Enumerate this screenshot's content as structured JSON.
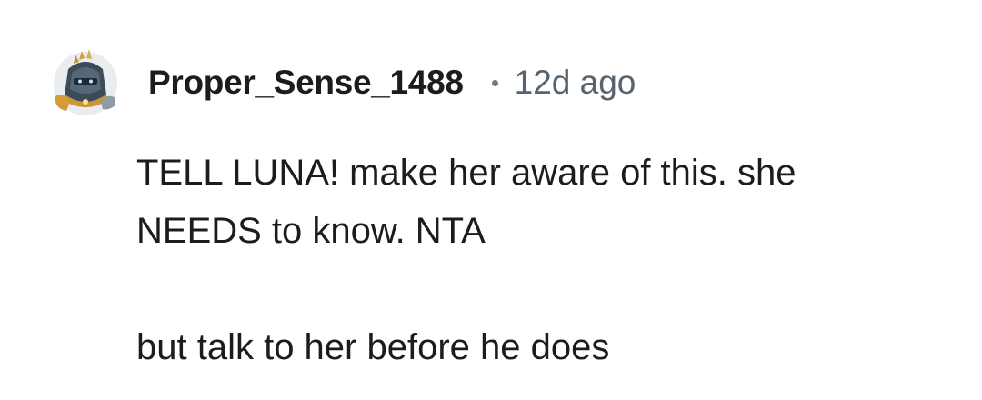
{
  "comment": {
    "avatar_icon": "knight-helmet-avatar-icon",
    "username": "Proper_Sense_1488",
    "separator": "•",
    "timestamp": "12d ago",
    "lines": [
      "TELL LUNA! make her aware of this. she",
      "NEEDS to know. NTA",
      "but talk to her before he does"
    ]
  },
  "colors": {
    "background": "#ffffff",
    "text": "#1c1c1c",
    "meta_text": "#57636e"
  }
}
